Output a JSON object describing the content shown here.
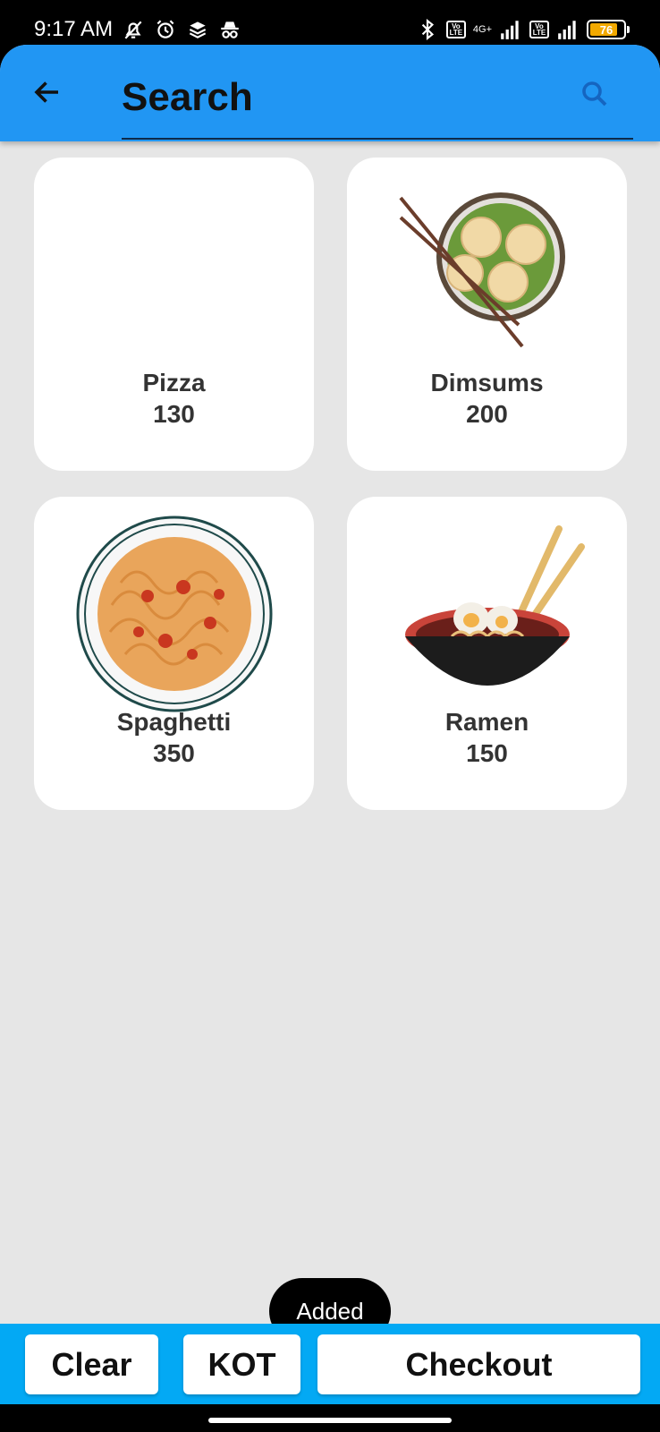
{
  "status_bar": {
    "time": "9:17 AM",
    "network_label": "4G+",
    "volte_label": "Vo\nLTE",
    "battery_level": "76",
    "icons": [
      "bell-off-icon",
      "alarm-icon",
      "layers-icon",
      "incognito-icon",
      "bluetooth-icon",
      "signal-icon",
      "battery-icon"
    ]
  },
  "header": {
    "search_placeholder": "Search",
    "back_icon": "arrow-left-icon",
    "search_icon": "search-icon"
  },
  "items": [
    {
      "name": "Pizza",
      "price": "130",
      "image": "none"
    },
    {
      "name": "Dimsums",
      "price": "200",
      "image": "dimsum-basket-icon"
    },
    {
      "name": "Spaghetti",
      "price": "350",
      "image": "spaghetti-plate-icon"
    },
    {
      "name": "Ramen",
      "price": "150",
      "image": "ramen-bowl-icon"
    }
  ],
  "toast": {
    "message": "Added"
  },
  "actions": {
    "clear_label": "Clear",
    "kot_label": "KOT",
    "checkout_label": "Checkout"
  },
  "colors": {
    "app_bar": "#2196f3",
    "bottom_bar": "#03a9f4",
    "background": "#e6e6e6",
    "card": "#ffffff",
    "battery": "#f2a900"
  }
}
